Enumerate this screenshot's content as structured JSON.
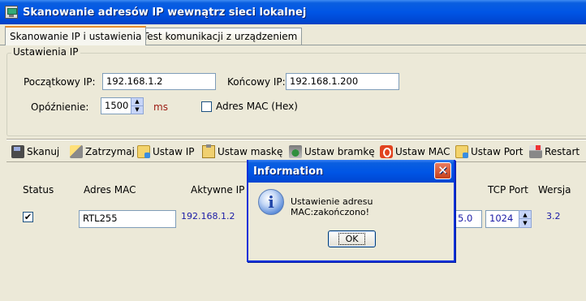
{
  "window": {
    "title": "Skanowanie adresów IP wewnątrz sieci lokalnej"
  },
  "tabs": [
    {
      "label": "Skanowanie IP i ustawienia",
      "active": true
    },
    {
      "label": "Test komunikacji z urządzeniem",
      "active": false
    }
  ],
  "settings": {
    "group_title": "Ustawienia IP",
    "start_ip_label": "Początkowy IP:",
    "start_ip_value": "192.168.1.2",
    "end_ip_label": "Końcowy IP:",
    "end_ip_value": "192.168.1.200",
    "delay_label": "Opóźnienie:",
    "delay_value": "1500",
    "delay_unit": "ms",
    "mac_hex_label": "Adres MAC (Hex)",
    "mac_hex_checked": false
  },
  "toolbar": {
    "scan": "Skanuj",
    "stop": "Zatrzymaj",
    "set_ip": "Ustaw IP",
    "set_mask": "Ustaw maskę",
    "set_gateway": "Ustaw bramkę",
    "set_mac": "Ustaw MAC",
    "set_port": "Ustaw Port",
    "restart": "Restart"
  },
  "table": {
    "columns": {
      "status": "Status",
      "mac": "Adres MAC",
      "active_ip": "Aktywne IP",
      "tcp_port": "TCP Port",
      "version": "Wersja"
    },
    "row": {
      "status_checked": true,
      "mac": "RTL255",
      "active_ip": "192.168.1.2",
      "partial_ip": "5.0",
      "tcp_port": "1024",
      "version": "3.2"
    }
  },
  "dialog": {
    "title": "Information",
    "message": "Ustawienie adresu MAC:zakończono!",
    "ok_label": "OK"
  },
  "colors": {
    "title_bar": "#0055e5",
    "window_bg": "#ece9d8",
    "value_blue": "#1a1aa6",
    "unit_red": "#9b1b12",
    "close_red": "#c6401b"
  }
}
